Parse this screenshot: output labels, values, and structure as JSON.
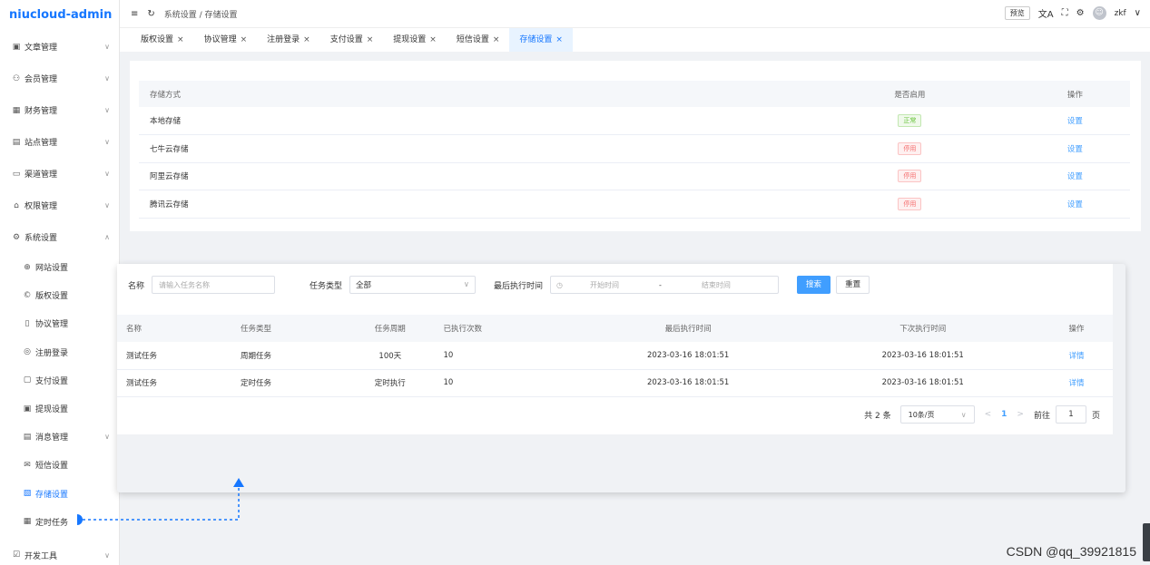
{
  "app": {
    "name": "niucloud-admin"
  },
  "sidebar": {
    "items": [
      {
        "icon": "▣",
        "label": "文章管理",
        "arrow": "∨"
      },
      {
        "icon": "⚇",
        "label": "会员管理",
        "arrow": "∨"
      },
      {
        "icon": "▦",
        "label": "财务管理",
        "arrow": "∨"
      },
      {
        "icon": "▤",
        "label": "站点管理",
        "arrow": "∨"
      },
      {
        "icon": "▭",
        "label": "渠道管理",
        "arrow": "∨"
      },
      {
        "icon": "⌂",
        "label": "权限管理",
        "arrow": "∨"
      },
      {
        "icon": "⚙",
        "label": "系统设置",
        "arrow": "∧"
      }
    ],
    "sub_items": [
      {
        "icon": "⊕",
        "label": "网站设置"
      },
      {
        "icon": "©",
        "label": "版权设置"
      },
      {
        "icon": "▯",
        "label": "协议管理"
      },
      {
        "icon": "◎",
        "label": "注册登录"
      },
      {
        "icon": "▢",
        "label": "支付设置"
      },
      {
        "icon": "▣",
        "label": "提现设置"
      },
      {
        "icon": "▤",
        "label": "消息管理",
        "arrow": "∨"
      },
      {
        "icon": "✉",
        "label": "短信设置"
      },
      {
        "icon": "▧",
        "label": "存储设置"
      },
      {
        "icon": "▦",
        "label": "定时任务"
      }
    ],
    "bottom_item": {
      "icon": "☑",
      "label": "开发工具",
      "arrow": "∨"
    }
  },
  "topbar": {
    "breadcrumb": "系统设置 / 存储设置",
    "preview_label": "预览",
    "username": "zkf",
    "icons": {
      "menu": "≡",
      "refresh": "↻",
      "lang": "文A",
      "fullscreen": "⛶",
      "settings": "⚙",
      "chevron": "∨"
    }
  },
  "tabs": [
    {
      "label": "版权设置",
      "close": "×"
    },
    {
      "label": "协议管理",
      "close": "×"
    },
    {
      "label": "注册登录",
      "close": "×"
    },
    {
      "label": "支付设置",
      "close": "×"
    },
    {
      "label": "提现设置",
      "close": "×"
    },
    {
      "label": "短信设置",
      "close": "×"
    },
    {
      "label": "存储设置",
      "close": "×"
    }
  ],
  "storage": {
    "headers": {
      "name": "存储方式",
      "enabled": "是否启用",
      "op": "操作"
    },
    "rows": [
      {
        "name": "本地存储",
        "status": "正常",
        "op": "设置"
      },
      {
        "name": "七牛云存储",
        "status": "停用",
        "op": "设置"
      },
      {
        "name": "阿里云存储",
        "status": "停用",
        "op": "设置"
      },
      {
        "name": "腾讯云存储",
        "status": "停用",
        "op": "设置"
      }
    ]
  },
  "cron": {
    "filter": {
      "name_label": "名称",
      "name_placeholder": "请输入任务名称",
      "type_label": "任务类型",
      "type_value": "全部",
      "time_label": "最后执行时间",
      "start_placeholder": "开始时间",
      "separator": "-",
      "end_placeholder": "结束时间",
      "search": "搜索",
      "reset": "重置",
      "clock_icon": "◷",
      "chevron": "∨"
    },
    "headers": [
      "名称",
      "任务类型",
      "任务周期",
      "已执行次数",
      "最后执行时间",
      "下次执行时间",
      "操作"
    ],
    "rows": [
      [
        "测试任务",
        "周期任务",
        "100天",
        "10",
        "2023-03-16 18:01:51",
        "2023-03-16 18:01:51",
        "详情"
      ],
      [
        "测试任务",
        "定时任务",
        "定时执行",
        "10",
        "2023-03-16 18:01:51",
        "2023-03-16 18:01:51",
        "详情"
      ]
    ],
    "pager": {
      "total": "共 2 条",
      "size": "10条/页",
      "prev": "<",
      "page": "1",
      "next": ">",
      "goto": "前往",
      "goto_value": "1",
      "unit": "页",
      "chevron": "∨"
    }
  },
  "watermark": "CSDN @qq_39921815",
  "colors": {
    "brand": "#1677ff",
    "link": "#409eff",
    "ok": "#67c23a",
    "off": "#f56c6c"
  }
}
